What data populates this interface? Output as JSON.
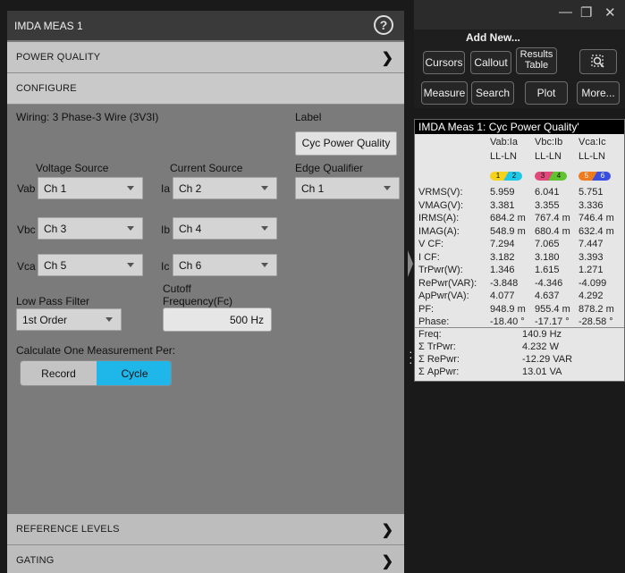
{
  "window": {
    "title": "IMDA MEAS 1",
    "help_glyph": "?"
  },
  "sections": {
    "power_quality": "POWER QUALITY",
    "configure": "CONFIGURE",
    "reference_levels": "REFERENCE LEVELS",
    "gating": "GATING",
    "chevron": "❯"
  },
  "configure": {
    "wiring": "Wiring: 3 Phase-3 Wire (3V3I)",
    "label_title": "Label",
    "label_value": "Cyc Power Quality",
    "voltage_source_title": "Voltage Source",
    "current_source_title": "Current Source",
    "edge_qualifier_title": "Edge Qualifier",
    "rows": [
      {
        "v_label": "Vab",
        "v_value": "Ch 1",
        "i_label": "Ia",
        "i_value": "Ch 2"
      },
      {
        "v_label": "Vbc",
        "v_value": "Ch 3",
        "i_label": "Ib",
        "i_value": "Ch 4"
      },
      {
        "v_label": "Vca",
        "v_value": "Ch 5",
        "i_label": "Ic",
        "i_value": "Ch 6"
      }
    ],
    "edge_qualifier_value": "Ch 1",
    "low_pass_title": "Low Pass Filter",
    "low_pass_value": "1st Order",
    "cutoff_title_1": "Cutoff",
    "cutoff_title_2": "Frequency(Fc)",
    "cutoff_value": "500 Hz",
    "calc_title": "Calculate One Measurement Per:",
    "toggle_record": "Record",
    "toggle_cycle": "Cycle",
    "toggle_selected": "Cycle"
  },
  "add_new": {
    "title": "Add New...",
    "buttons": {
      "cursors": "Cursors",
      "callout": "Callout",
      "results_table_1": "Results",
      "results_table_2": "Table",
      "measure": "Measure",
      "search": "Search",
      "plot": "Plot",
      "more": "More..."
    }
  },
  "window_controls": {
    "minimize": "—",
    "restore": "❐",
    "close": "✕"
  },
  "badge": {
    "header": "IMDA Meas 1: Cyc Power Quality'",
    "columns": [
      {
        "name": "Vab:Ia",
        "mode": "LL-LN",
        "ch_v": "1",
        "ch_i": "2",
        "color_v": "#f5d21b",
        "color_i": "#1fc7e8"
      },
      {
        "name": "Vbc:Ib",
        "mode": "LL-LN",
        "ch_v": "3",
        "ch_i": "4",
        "color_v": "#e04a7a",
        "color_i": "#5fc430"
      },
      {
        "name": "Vca:Ic",
        "mode": "LL-LN",
        "ch_v": "5",
        "ch_i": "6",
        "color_v": "#f07a1e",
        "color_i": "#3a4fe0"
      }
    ],
    "rows": [
      {
        "label": "VRMS(V):",
        "v": [
          "5.959",
          "6.041",
          "5.751"
        ]
      },
      {
        "label": "VMAG(V):",
        "v": [
          "3.381",
          "3.355",
          "3.336"
        ]
      },
      {
        "label": "IRMS(A):",
        "v": [
          "684.2 m",
          "767.4 m",
          "746.4 m"
        ]
      },
      {
        "label": "IMAG(A):",
        "v": [
          "548.9 m",
          "680.4 m",
          "632.4 m"
        ]
      },
      {
        "label": "V CF:",
        "v": [
          "7.294",
          "7.065",
          "7.447"
        ]
      },
      {
        "label": "I CF:",
        "v": [
          "3.182",
          "3.180",
          "3.393"
        ]
      },
      {
        "label": "TrPwr(W):",
        "v": [
          "1.346",
          "1.615",
          "1.271"
        ]
      },
      {
        "label": "RePwr(VAR):",
        "v": [
          "-3.848",
          "-4.346",
          "-4.099"
        ]
      },
      {
        "label": "ApPwr(VA):",
        "v": [
          "4.077",
          "4.637",
          "4.292"
        ]
      },
      {
        "label": "PF:",
        "v": [
          "948.9 m",
          "955.4 m",
          "878.2 m"
        ]
      },
      {
        "label": "Phase:",
        "v": [
          "-18.40 °",
          "-17.17 °",
          "-28.58 °"
        ]
      }
    ],
    "totals": [
      {
        "label": "Freq:",
        "value": "140.9 Hz"
      },
      {
        "label": "Σ TrPwr:",
        "value": "4.232 W"
      },
      {
        "label": "Σ RePwr:",
        "value": "-12.29 VAR"
      },
      {
        "label": "Σ ApPwr:",
        "value": "13.01 VA"
      }
    ]
  }
}
